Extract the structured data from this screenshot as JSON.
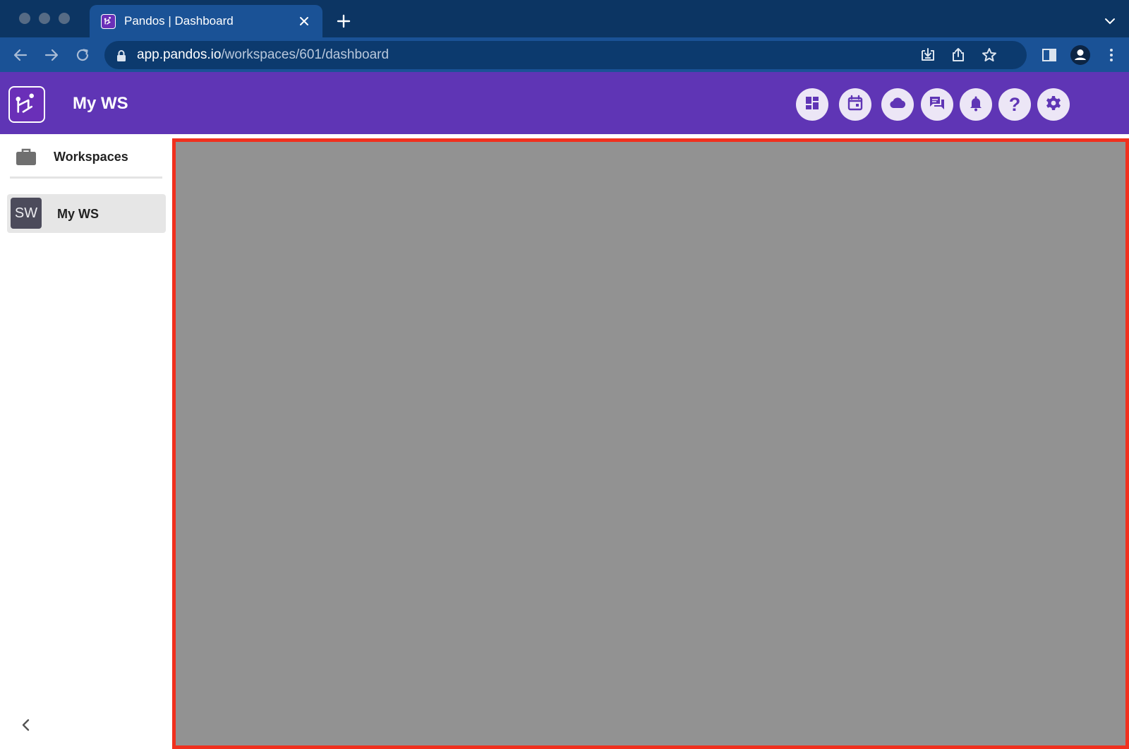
{
  "browser": {
    "tab_title": "Pandos | Dashboard",
    "url_host": "app.pandos.io",
    "url_path": "/workspaces/601/dashboard",
    "icons": [
      "back-arrow-icon",
      "forward-arrow-icon",
      "reload-icon",
      "lock-icon",
      "install-app-icon",
      "share-icon",
      "bookmark-star-icon",
      "side-panel-icon",
      "profile-icon",
      "kebab-menu-icon"
    ]
  },
  "app": {
    "workspace_title": "My WS",
    "brand_color": "#5f35b5",
    "header_buttons": [
      {
        "name": "dashboard-icon"
      },
      {
        "name": "calendar-icon"
      },
      {
        "name": "cloud-icon"
      },
      {
        "name": "chat-icon"
      },
      {
        "name": "notifications-bell-icon"
      },
      {
        "name": "help-icon",
        "label": "?"
      },
      {
        "name": "settings-gear-icon"
      }
    ]
  },
  "sidebar": {
    "header_label": "Workspaces",
    "items": [
      {
        "avatar": "SW",
        "label": "My WS",
        "selected": true
      }
    ]
  },
  "main": {
    "background": "#929292",
    "border_color": "#f0301e"
  }
}
